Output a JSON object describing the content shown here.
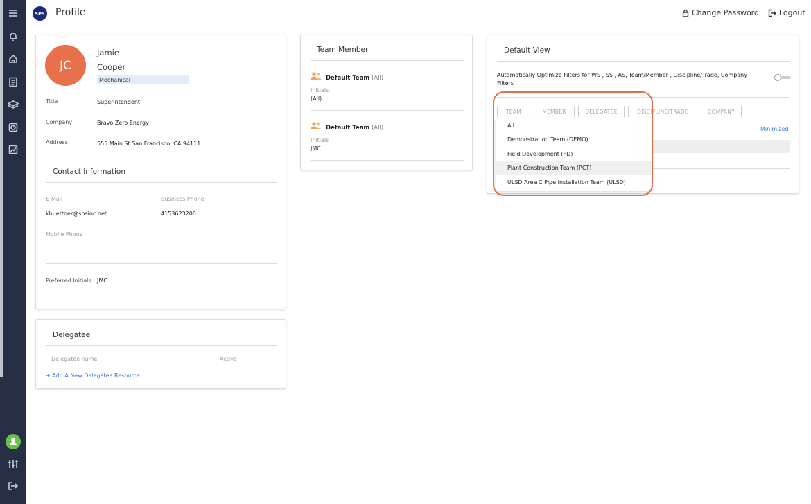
{
  "header": {
    "logo_text": "SPS",
    "title": "Profile",
    "change_password": "Change Password",
    "logout": "Logout"
  },
  "sidebar": {
    "icons": [
      "menu-icon",
      "bell-icon",
      "home-icon",
      "list-icon",
      "layers-icon",
      "clock-icon",
      "chart-icon"
    ],
    "bottom_icons": [
      "user-icon",
      "sliders-icon",
      "logout-icon"
    ],
    "user_icon_color": "#6cbf4a"
  },
  "profile": {
    "initials": "JC",
    "first_name": "Jamie",
    "last_name": "Cooper",
    "department": "Mechanical",
    "avatar_color": "#e8714b",
    "fields": [
      {
        "label": "Title",
        "value": "Superintendent"
      },
      {
        "label": "Company",
        "value": "Bravo Zero Energy"
      },
      {
        "label": "Address",
        "value": "555 Main St.San Francisco, CA 94111"
      }
    ],
    "contact_heading": "Contact Information",
    "email_label": "E-Mail",
    "email_value": "kbuettner@spsinc.net",
    "business_phone_label": "Business Phone",
    "business_phone_value": "4153623200",
    "mobile_phone_label": "Mobile Phone",
    "preferred_initials_label": "Preferred Initials",
    "preferred_initials_value": "JMC"
  },
  "delegatee": {
    "heading": "Delegatee",
    "col_name": "Delegatee name",
    "col_active": "Active",
    "add_link": "+ Add A New Delegatee Resource"
  },
  "team_member": {
    "heading": "Team Member",
    "entries": [
      {
        "team": "Default Team",
        "scope": "(All)",
        "initials_label": "Initials",
        "initials_value": "(All)"
      },
      {
        "team": "Default Team",
        "scope": "(All)",
        "initials_label": "Initials",
        "initials_value": "JMC"
      }
    ]
  },
  "default_view": {
    "heading": "Default View",
    "optimize_text_line1": "Automatically Optimize Filters for WS , SS , AS, Team/Member , Discipline/Trade, Company",
    "optimize_text_line2": "Filters",
    "toggle_on": false,
    "tabs": [
      "TEAM",
      "MEMBER",
      "DELEGATEE",
      "DISCIPLINE/TRADE",
      "COMPANY"
    ],
    "minimized_link": "Minimized",
    "dropdown_options": [
      "All",
      "Demonstration Team (DEMO)",
      "Field Development (FD)",
      "Plant Construction Team (PCT)",
      "ULSD Area C Pipe Installation Team (ULSD)"
    ],
    "highlighted_option": "Plant Construction Team (PCT)",
    "highlight_ring_color": "#e26e48"
  }
}
